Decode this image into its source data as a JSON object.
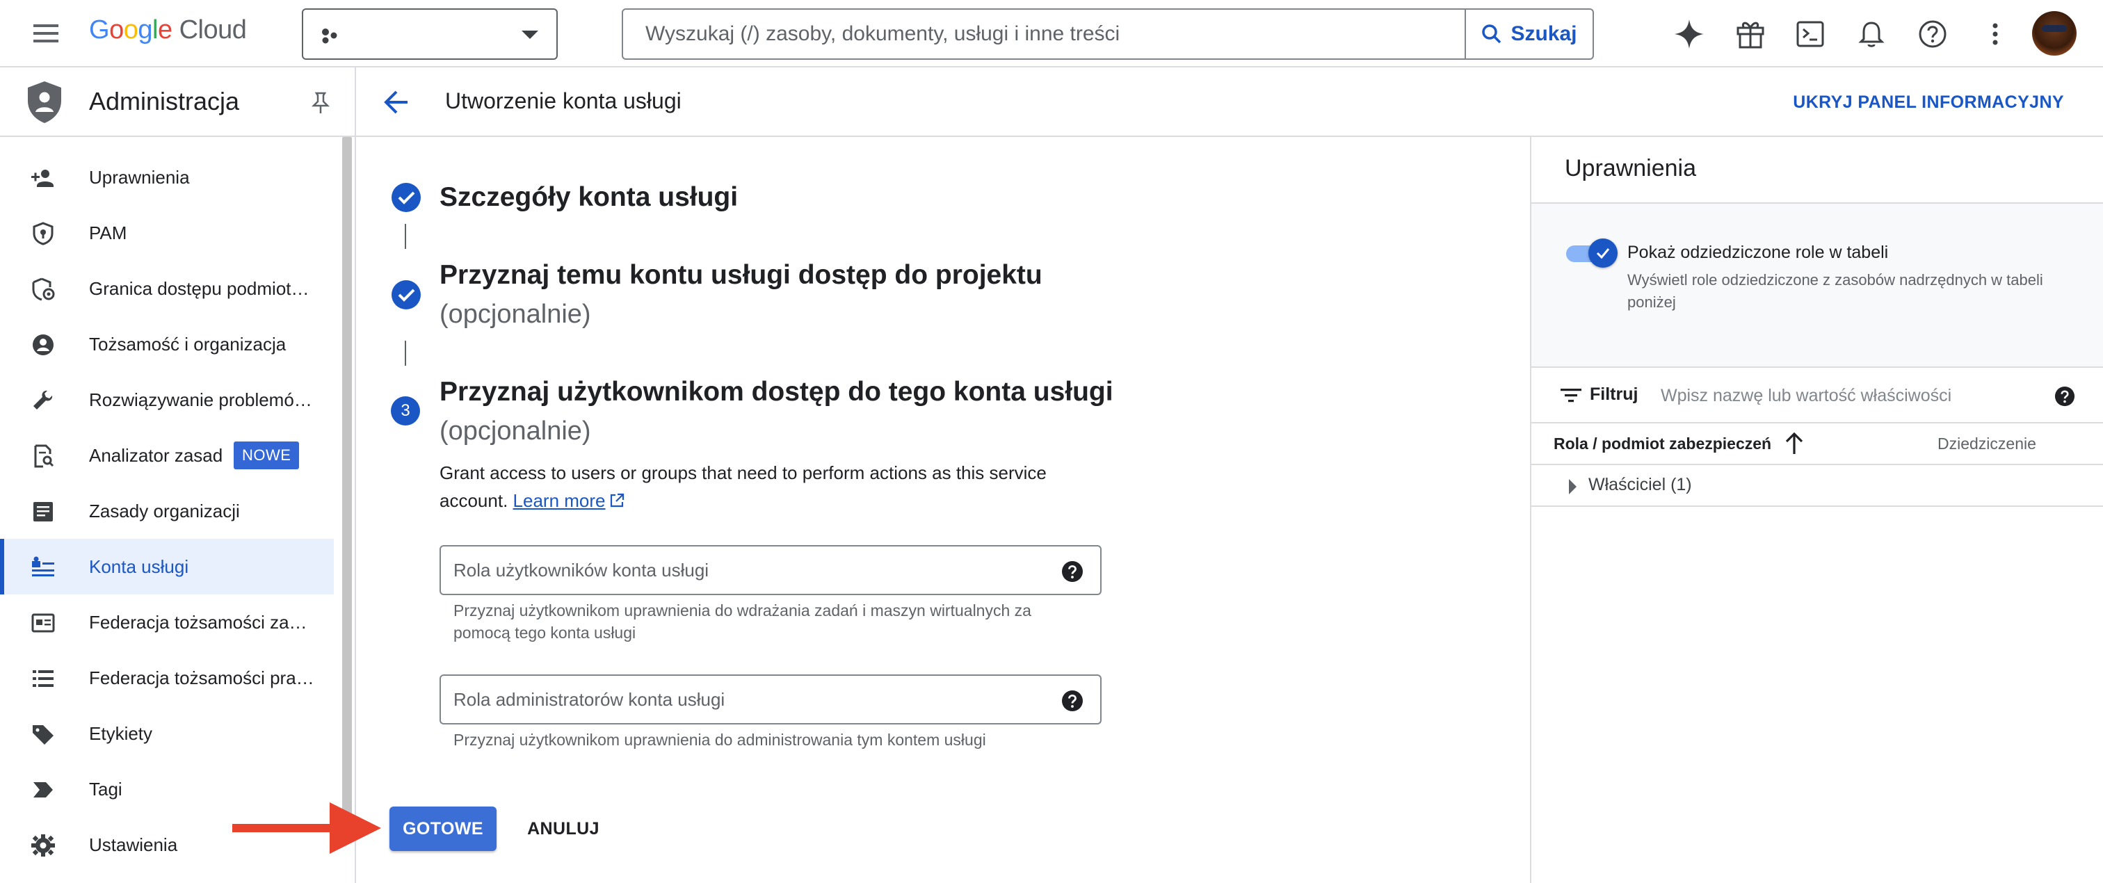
{
  "topbar": {
    "logo_google": "Google",
    "logo_cloud": "Cloud",
    "search_placeholder": "Wyszukaj (/) zasoby, dokumenty, usługi i inne treści",
    "search_button": "Szukaj",
    "icons": [
      "menu-icon",
      "project-picker-icon",
      "search-icon",
      "gemini-icon",
      "gift-icon",
      "cloud-shell-icon",
      "notifications-icon",
      "help-icon",
      "more-vert-icon"
    ]
  },
  "sidebar": {
    "title": "Administracja",
    "items": [
      {
        "label": "Uprawnienia",
        "icon": "person-add-icon"
      },
      {
        "label": "PAM",
        "icon": "shield-icon"
      },
      {
        "label": "Granica dostępu podmiot…",
        "icon": "boundary-icon"
      },
      {
        "label": "Tożsamość i organizacja",
        "icon": "account-circle-icon"
      },
      {
        "label": "Rozwiązywanie problemó…",
        "icon": "wrench-icon"
      },
      {
        "label": "Analizator zasad",
        "icon": "policy-analyzer-icon",
        "badge": "NOWE"
      },
      {
        "label": "Zasady organizacji",
        "icon": "list-alt-icon"
      },
      {
        "label": "Konta usługi",
        "icon": "service-account-icon",
        "active": true
      },
      {
        "label": "Federacja tożsamości za…",
        "icon": "id-card-icon"
      },
      {
        "label": "Federacja tożsamości pra…",
        "icon": "list-icon"
      },
      {
        "label": "Etykiety",
        "icon": "label-icon"
      },
      {
        "label": "Tagi",
        "icon": "tag-icon"
      },
      {
        "label": "Ustawienia",
        "icon": "settings-icon"
      }
    ]
  },
  "main": {
    "title": "Utworzenie konta usługi",
    "hide_panel": "UKRYJ PANEL INFORMACYJNY",
    "steps": [
      {
        "title": "Szczegóły konta usługi",
        "state": "done"
      },
      {
        "title": "Przyznaj temu kontu usługi dostęp do projektu",
        "optional": "(opcjonalnie)",
        "state": "done"
      },
      {
        "number": "3",
        "title": "Przyznaj użytkownikom dostęp do tego konta usługi",
        "optional": "(opcjonalnie)",
        "state": "active"
      }
    ],
    "description_a": "Grant access to users or groups that need to perform actions as this service",
    "description_b": "account.",
    "learn_more": "Learn more",
    "fields": [
      {
        "placeholder": "Rola użytkowników konta usługi",
        "hint": "Przyznaj użytkownikom uprawnienia do wdrażania zadań i maszyn wirtualnych za pomocą tego konta usługi"
      },
      {
        "placeholder": "Rola administratorów konta usługi",
        "hint": "Przyznaj użytkownikom uprawnienia do administrowania tym kontem usługi"
      }
    ],
    "done_button": "GOTOWE",
    "cancel_button": "ANULUJ"
  },
  "info_panel": {
    "title": "Uprawnienia",
    "toggle_label": "Pokaż odziedziczone role w tabeli",
    "toggle_on": true,
    "toggle_desc": "Wyświetl role odziedziczone z zasobów nadrzędnych w tabeli poniżej",
    "filter_label": "Filtruj",
    "filter_placeholder": "Wpisz nazwę lub wartość właściwości",
    "col_role": "Rola / podmiot zabezpieczeń",
    "col_inherit": "Dziedziczenie",
    "rows": [
      {
        "label": "Właściciel (1)"
      }
    ]
  },
  "colors": {
    "accent": "#1a56c4",
    "annotation_arrow": "#e8412c"
  }
}
